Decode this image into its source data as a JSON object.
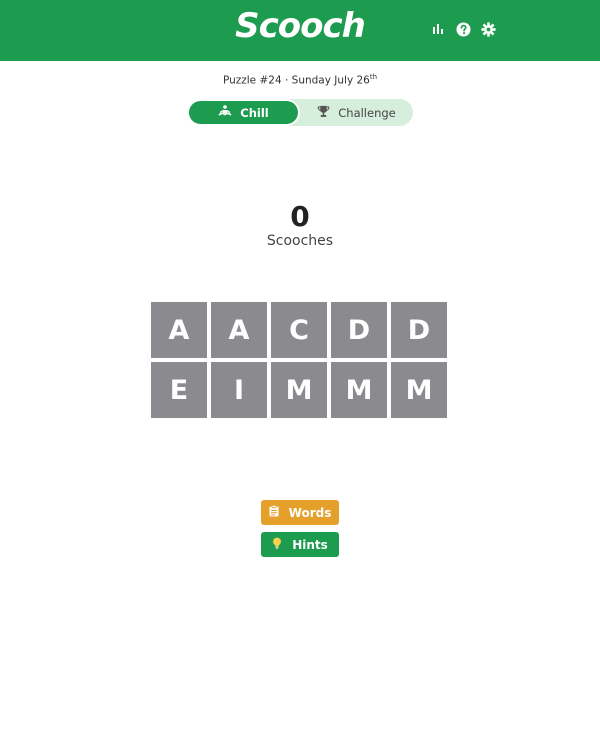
{
  "header": {
    "logo_text": "Scooch",
    "icons": [
      "stats-icon",
      "help-icon",
      "settings-icon"
    ],
    "brand_color": "#1d9b4e"
  },
  "puzzle": {
    "info_prefix": "Puzzle #24 · Sunday July 26",
    "info_suffix": "th"
  },
  "modes": {
    "chill_label": "Chill",
    "challenge_label": "Challenge",
    "selected": "Chill"
  },
  "score": {
    "value": "0",
    "label": "Scooches"
  },
  "tiles": [
    "A",
    "A",
    "C",
    "D",
    "D",
    "E",
    "I",
    "M",
    "M",
    "M"
  ],
  "actions": {
    "words_label": "Words",
    "hints_label": "Hints",
    "words_color": "#e4a02b",
    "hints_color": "#1d9b4e"
  }
}
